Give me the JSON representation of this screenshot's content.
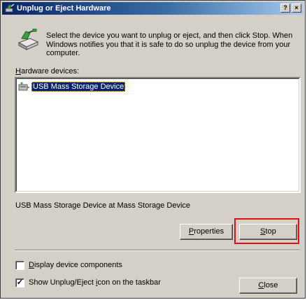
{
  "window": {
    "title": "Unplug or Eject Hardware",
    "help_glyph": "?",
    "close_glyph": "×"
  },
  "instructions": "Select the device you want to unplug or eject, and then click Stop. When Windows notifies you that it is safe to do so unplug the device from your computer.",
  "hardware_label": {
    "before": "",
    "accel": "H",
    "after": "ardware devices:"
  },
  "devices": [
    {
      "label": "USB Mass Storage Device",
      "selected": true,
      "icon": "usb-device-icon"
    }
  ],
  "device_description": "USB Mass Storage Device at Mass Storage Device",
  "buttons": {
    "properties": {
      "before": "",
      "accel": "P",
      "after": "roperties"
    },
    "stop": {
      "before": "",
      "accel": "S",
      "after": "top"
    },
    "close": {
      "before": "",
      "accel": "C",
      "after": "lose"
    }
  },
  "options": {
    "display_components": {
      "before": "",
      "accel": "D",
      "after": "isplay device components",
      "checked": false
    },
    "show_icon": {
      "before": "Show Unplug/Eject ",
      "accel": "i",
      "after": "con on the taskbar",
      "checked": true
    }
  },
  "check_mark": "✓",
  "colors": {
    "title_start": "#0a246a",
    "title_end": "#a6caf0",
    "face": "#d4d0c8",
    "selection": "#0a246a",
    "highlight": "#e01010"
  }
}
